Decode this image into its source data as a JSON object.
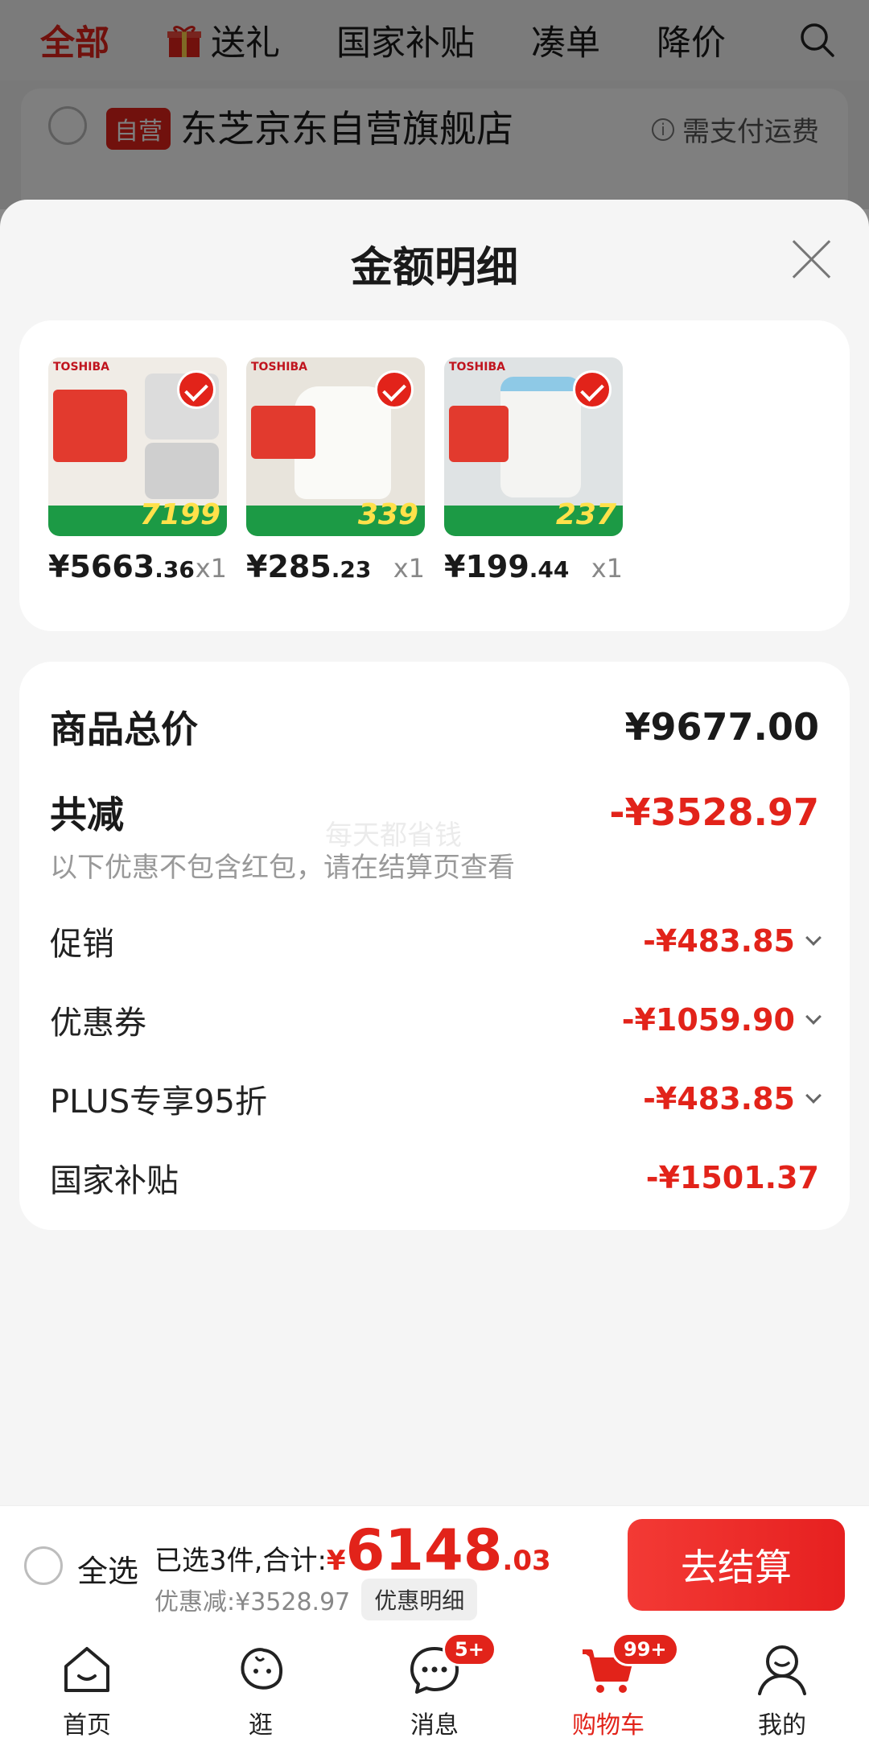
{
  "header_tabs": {
    "all": "全部",
    "gift": "送礼",
    "subsidy": "国家补贴",
    "bundle": "凑单",
    "price_drop": "降价"
  },
  "store": {
    "badge": "自营",
    "name": "东芝京东自营旗舰店",
    "shipping_note": "需支付运费"
  },
  "sheet": {
    "title": "金额明细"
  },
  "products": [
    {
      "price_int": "¥5663",
      "price_dec": ".36",
      "qty": "x1",
      "thumb_price": "7199"
    },
    {
      "price_int": "¥285",
      "price_dec": ".23",
      "qty": "x1",
      "thumb_price": "339"
    },
    {
      "price_int": "¥199",
      "price_dec": ".44",
      "qty": "x1",
      "thumb_price": "237"
    }
  ],
  "summary": {
    "total_label": "商品总价",
    "total_value": "¥9677.00",
    "reduce_label": "共减",
    "reduce_value": "-¥3528.97",
    "note": "以下优惠不包含红包，请在结算页查看",
    "watermark": "每天都省钱",
    "lines": [
      {
        "label": "促销",
        "value": "-¥483.85",
        "expandable": true
      },
      {
        "label": "优惠券",
        "value": "-¥1059.90",
        "expandable": true
      },
      {
        "label": "PLUS专享95折",
        "value": "-¥483.85",
        "expandable": true
      },
      {
        "label": "国家补贴",
        "value": "-¥1501.37",
        "expandable": false
      }
    ]
  },
  "checkout": {
    "select_all": "全选",
    "selected_text": "已选3件,合计:",
    "currency": "¥",
    "amount_int": "6148",
    "amount_dec": ".03",
    "discount_text": "优惠减:¥3528.97",
    "detail_button": "优惠明细",
    "pay_button": "去结算"
  },
  "tabbar": [
    {
      "label": "首页",
      "icon": "home-icon"
    },
    {
      "label": "逛",
      "icon": "browse-icon"
    },
    {
      "label": "消息",
      "icon": "message-icon",
      "badge": "5+"
    },
    {
      "label": "购物车",
      "icon": "cart-icon",
      "badge": "99+",
      "active": true
    },
    {
      "label": "我的",
      "icon": "profile-icon"
    }
  ],
  "colors": {
    "accent": "#e2231a",
    "promo_green": "#1c9a45"
  }
}
